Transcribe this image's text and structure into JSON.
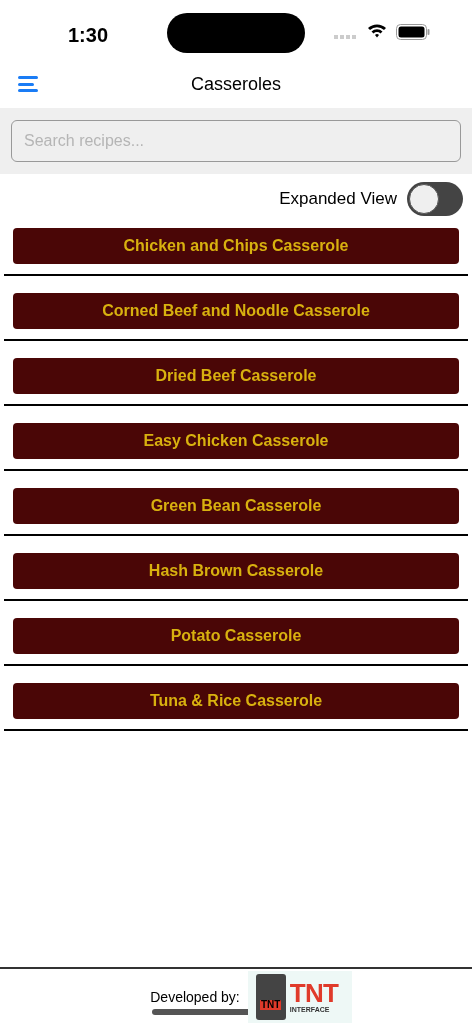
{
  "status_bar": {
    "time": "1:30"
  },
  "header": {
    "title": "Casseroles"
  },
  "search": {
    "placeholder": "Search recipes..."
  },
  "expanded_view": {
    "label": "Expanded View",
    "on": false
  },
  "recipes": [
    {
      "label": "Chicken and Chips Casserole"
    },
    {
      "label": "Corned Beef and Noodle Casserole"
    },
    {
      "label": "Dried Beef Casserole"
    },
    {
      "label": "Easy Chicken Casserole"
    },
    {
      "label": "Green Bean Casserole"
    },
    {
      "label": "Hash Brown Casserole"
    },
    {
      "label": "Potato Casserole"
    },
    {
      "label": "Tuna & Rice Casserole"
    }
  ],
  "footer": {
    "label": "Developed by:",
    "logo_icon_text": "TNT",
    "logo_title": "TNT",
    "logo_subtitle": "INTERFACE"
  }
}
